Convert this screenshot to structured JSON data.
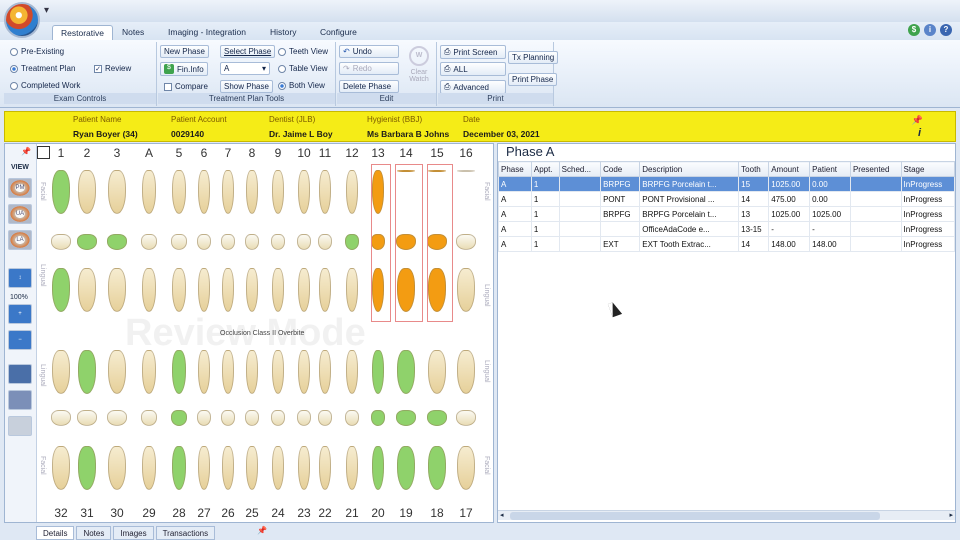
{
  "titlebar": {
    "quick_access": "▾"
  },
  "tabs": [
    {
      "label": "Restorative",
      "active": true
    },
    {
      "label": "Notes"
    },
    {
      "label": "Imaging - Integration"
    },
    {
      "label": "History"
    },
    {
      "label": "Configure"
    }
  ],
  "ribbon": {
    "exam_controls": {
      "label": "Exam Controls",
      "pre_existing": "Pre-Existing",
      "treatment_plan": "Treatment Plan",
      "completed_work": "Completed Work",
      "review": "Review"
    },
    "treatment_plan_tools": {
      "label": "Treatment Plan Tools",
      "new_phase": "New Phase",
      "select_phase": "Select Phase",
      "fin_info": "Fin.Info",
      "phase_value": "A",
      "compare": "Compare",
      "show_phase": "Show Phase",
      "teeth_view": "Teeth View",
      "table_view": "Table View",
      "both_view": "Both View"
    },
    "edit": {
      "label": "Edit",
      "undo": "Undo",
      "redo": "Redo",
      "delete_phase": "Delete Phase",
      "clear_watch": "Clear Watch"
    },
    "print": {
      "label": "Print",
      "print_screen": "Print Screen",
      "all": "ALL",
      "advanced": "Advanced",
      "tx_planning": "Tx Planning",
      "print_phase": "Print Phase"
    }
  },
  "patient": {
    "name_label": "Patient Name",
    "name": "Ryan Boyer (34)",
    "account_label": "Patient Account",
    "account": "0029140",
    "dentist_label": "Dentist (JLB)",
    "dentist": "Dr. Jaime L Boy",
    "hygienist_label": "Hygienist (BBJ)",
    "hygienist": "Ms Barbara B Johns",
    "date_label": "Date",
    "date": "December 03, 2021"
  },
  "chart": {
    "view_label": "VIEW",
    "zoom": "100%",
    "top_numbers": [
      "1",
      "2",
      "3",
      "A",
      "5",
      "6",
      "7",
      "8",
      "9",
      "10",
      "11",
      "12",
      "13",
      "14",
      "15",
      "16"
    ],
    "bottom_numbers": [
      "32",
      "31",
      "30",
      "29",
      "28",
      "27",
      "26",
      "25",
      "24",
      "23",
      "22",
      "21",
      "20",
      "19",
      "18",
      "17"
    ],
    "watermark": "Review Mode",
    "occlusion": "Occlusion Class II Overbite",
    "side_labels": {
      "facial": "Facial",
      "lingual": "Lingual"
    },
    "left_buttons": [
      "PM",
      "UA",
      "LA"
    ]
  },
  "phase": {
    "title": "Phase A",
    "columns": [
      "Phase",
      "Appt.",
      "Sched...",
      "Code",
      "Description",
      "Tooth",
      "Amount",
      "Patient",
      "Presented",
      "Stage"
    ],
    "rows": [
      [
        "A",
        "1",
        "",
        "BRPFG",
        "BRPFG Porcelain t...",
        "15",
        "1025.00",
        "0.00",
        "",
        "InProgress"
      ],
      [
        "A",
        "1",
        "",
        "PONT",
        "PONT Provisional ...",
        "14",
        "475.00",
        "0.00",
        "",
        "InProgress"
      ],
      [
        "A",
        "1",
        "",
        "BRPFG",
        "BRPFG Porcelain t...",
        "13",
        "1025.00",
        "1025.00",
        "",
        "InProgress"
      ],
      [
        "A",
        "1",
        "",
        "",
        "OfficeAdaCode e...",
        "13-15",
        "-",
        "-",
        "",
        "InProgress"
      ],
      [
        "A",
        "1",
        "",
        "EXT",
        "EXT Tooth Extrac...",
        "14",
        "148.00",
        "148.00",
        "",
        "InProgress"
      ]
    ]
  },
  "bottom_tabs": [
    "Details",
    "Notes",
    "Images",
    "Transactions"
  ],
  "colors": {
    "highlight_bar": "#f5ec17",
    "selected_row": "#5d8fd6",
    "restoration": "#f39c12",
    "treatment": "#8fd26b"
  }
}
